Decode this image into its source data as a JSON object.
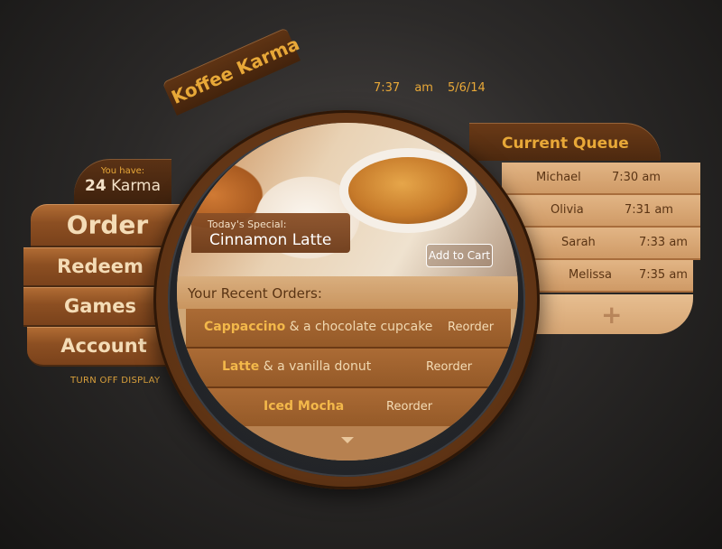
{
  "app": {
    "title": "Koffee Karma"
  },
  "clock": {
    "time": "7:37 am",
    "date": "5/6/14"
  },
  "karma": {
    "caption": "You have:",
    "amount": "24",
    "unit": "Karma"
  },
  "nav": {
    "order": "Order",
    "redeem": "Redeem",
    "games": "Games",
    "account": "Account",
    "turn_off": "TURN OFF DISPLAY"
  },
  "special": {
    "caption": "Today's Special:",
    "name": "Cinnamon Latte",
    "add_to_cart": "Add to Cart"
  },
  "recent": {
    "title": "Your Recent Orders:",
    "reorder_label": "Reorder",
    "orders": [
      {
        "item": "Cappaccino",
        "rest": " & a chocolate cupcake"
      },
      {
        "item": "Latte",
        "rest": " & a vanilla donut"
      },
      {
        "item": "Iced Mocha",
        "rest": ""
      }
    ]
  },
  "queue": {
    "title": "Current Queue",
    "rows": [
      {
        "name": "Michael",
        "time": "7:30 am"
      },
      {
        "name": "Olivia",
        "time": "7:31 am"
      },
      {
        "name": "Sarah",
        "time": "7:33 am"
      },
      {
        "name": "Melissa",
        "time": "7:35 am"
      }
    ],
    "add_symbol": "+"
  },
  "colors": {
    "accent": "#e8a838",
    "wood_dark": "#4d290f",
    "wood_mid": "#955a28",
    "cream": "#e2b585"
  }
}
